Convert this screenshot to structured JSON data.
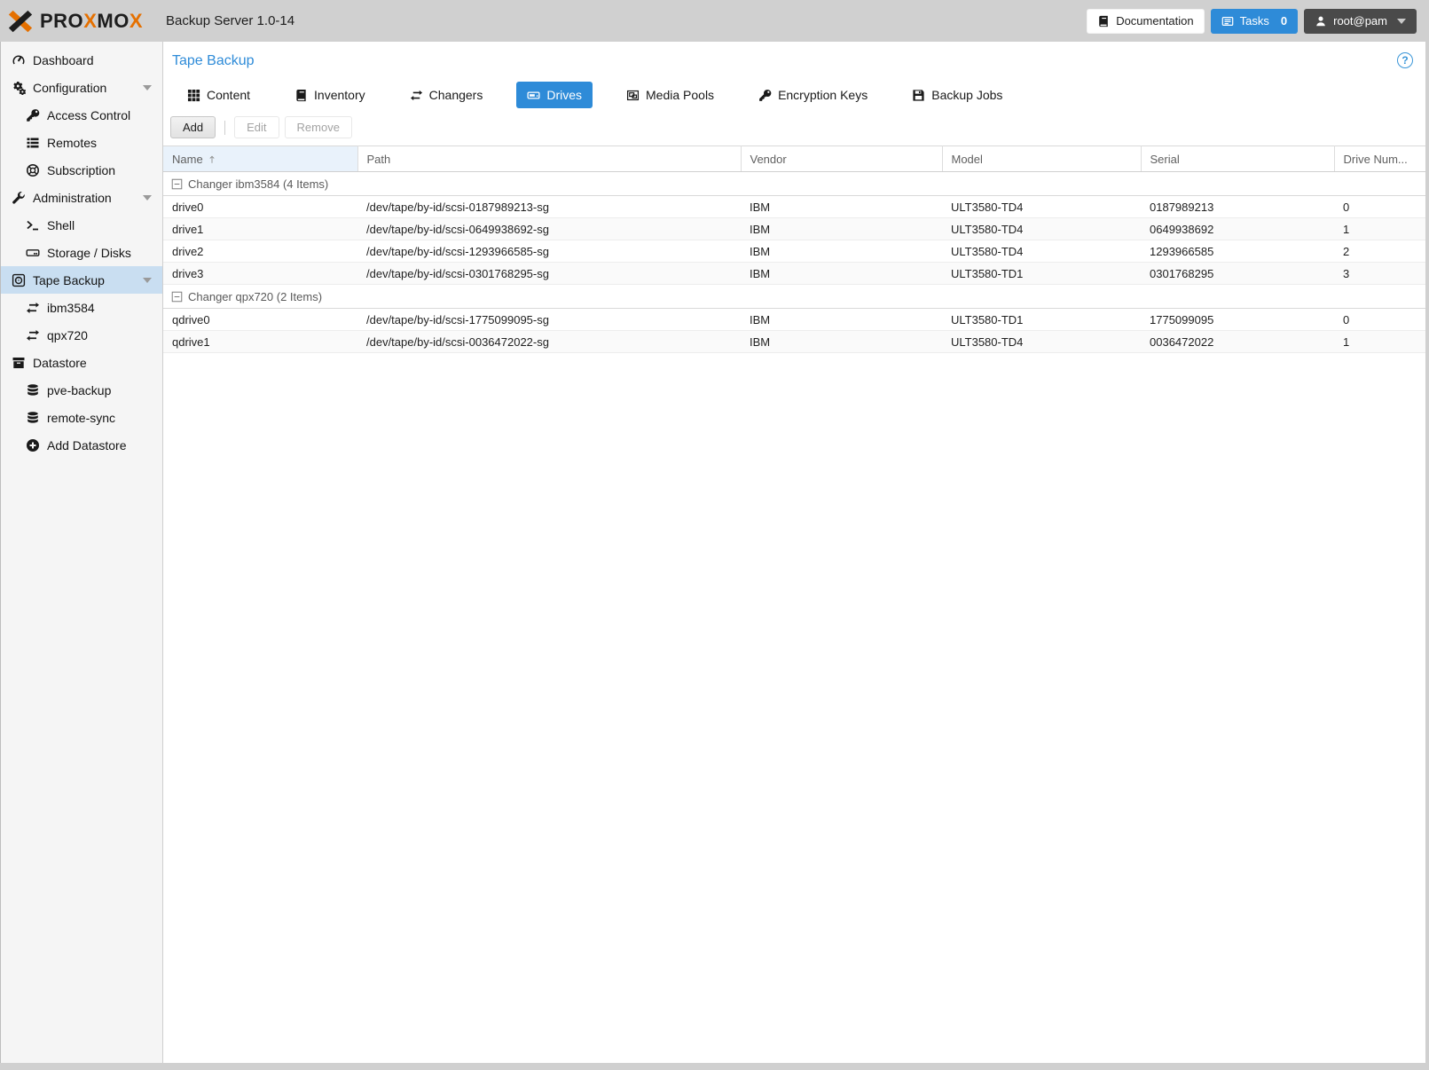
{
  "colors": {
    "accent": "#2e8bd8",
    "orange": "#e57000",
    "selected_nav": "#c9def1",
    "topbar": "#d0d0d0"
  },
  "topbar": {
    "logo_segments": [
      {
        "text": "PRO",
        "tone": "dark"
      },
      {
        "text": "X",
        "tone": "orange"
      },
      {
        "text": "MO",
        "tone": "dark"
      },
      {
        "text": "X",
        "tone": "orange"
      }
    ],
    "title": "Backup Server 1.0-14",
    "documentation_label": "Documentation",
    "tasks_label": "Tasks",
    "tasks_count": "0",
    "user_label": "root@pam"
  },
  "sidebar": {
    "items": [
      {
        "label": "Dashboard",
        "icon": "gauge",
        "level": 0,
        "selected": false,
        "collapsible": false
      },
      {
        "label": "Configuration",
        "icon": "cogs",
        "level": 0,
        "selected": false,
        "collapsible": true
      },
      {
        "label": "Access Control",
        "icon": "key",
        "level": 1,
        "selected": false,
        "collapsible": false
      },
      {
        "label": "Remotes",
        "icon": "list",
        "level": 1,
        "selected": false,
        "collapsible": false
      },
      {
        "label": "Subscription",
        "icon": "lifering",
        "level": 1,
        "selected": false,
        "collapsible": false
      },
      {
        "label": "Administration",
        "icon": "wrench",
        "level": 0,
        "selected": false,
        "collapsible": true
      },
      {
        "label": "Shell",
        "icon": "terminal",
        "level": 1,
        "selected": false,
        "collapsible": false
      },
      {
        "label": "Storage / Disks",
        "icon": "hdd",
        "level": 1,
        "selected": false,
        "collapsible": false
      },
      {
        "label": "Tape Backup",
        "icon": "tape",
        "level": 0,
        "selected": true,
        "collapsible": true
      },
      {
        "label": "ibm3584",
        "icon": "exchange",
        "level": 1,
        "selected": false,
        "collapsible": false
      },
      {
        "label": "qpx720",
        "icon": "exchange",
        "level": 1,
        "selected": false,
        "collapsible": false
      },
      {
        "label": "Datastore",
        "icon": "box",
        "level": 0,
        "selected": false,
        "collapsible": false
      },
      {
        "label": "pve-backup",
        "icon": "database",
        "level": 1,
        "selected": false,
        "collapsible": false
      },
      {
        "label": "remote-sync",
        "icon": "database",
        "level": 1,
        "selected": false,
        "collapsible": false
      },
      {
        "label": "Add Datastore",
        "icon": "pluscircle",
        "level": 1,
        "selected": false,
        "collapsible": false
      }
    ]
  },
  "main": {
    "page_title": "Tape Backup",
    "tabs": [
      {
        "label": "Content",
        "icon": "th",
        "active": false
      },
      {
        "label": "Inventory",
        "icon": "book",
        "active": false
      },
      {
        "label": "Changers",
        "icon": "exchange",
        "active": false
      },
      {
        "label": "Drives",
        "icon": "drive",
        "active": true
      },
      {
        "label": "Media Pools",
        "icon": "objectgroup",
        "active": false
      },
      {
        "label": "Encryption Keys",
        "icon": "key",
        "active": false
      },
      {
        "label": "Backup Jobs",
        "icon": "save",
        "active": false
      }
    ],
    "toolbar": {
      "add_label": "Add",
      "edit_label": "Edit",
      "remove_label": "Remove",
      "edit_disabled": true,
      "remove_disabled": true
    },
    "table": {
      "columns": [
        "Name",
        "Path",
        "Vendor",
        "Model",
        "Serial",
        "Drive Num..."
      ],
      "sorted_column": "Name",
      "sort_direction": "asc",
      "groups": [
        {
          "label": "Changer ibm3584 (4 Items)",
          "rows": [
            [
              "drive0",
              "/dev/tape/by-id/scsi-0187989213-sg",
              "IBM",
              "ULT3580-TD4",
              "0187989213",
              "0"
            ],
            [
              "drive1",
              "/dev/tape/by-id/scsi-0649938692-sg",
              "IBM",
              "ULT3580-TD4",
              "0649938692",
              "1"
            ],
            [
              "drive2",
              "/dev/tape/by-id/scsi-1293966585-sg",
              "IBM",
              "ULT3580-TD4",
              "1293966585",
              "2"
            ],
            [
              "drive3",
              "/dev/tape/by-id/scsi-0301768295-sg",
              "IBM",
              "ULT3580-TD1",
              "0301768295",
              "3"
            ]
          ]
        },
        {
          "label": "Changer qpx720 (2 Items)",
          "rows": [
            [
              "qdrive0",
              "/dev/tape/by-id/scsi-1775099095-sg",
              "IBM",
              "ULT3580-TD1",
              "1775099095",
              "0"
            ],
            [
              "qdrive1",
              "/dev/tape/by-id/scsi-0036472022-sg",
              "IBM",
              "ULT3580-TD4",
              "0036472022",
              "1"
            ]
          ]
        }
      ]
    }
  }
}
